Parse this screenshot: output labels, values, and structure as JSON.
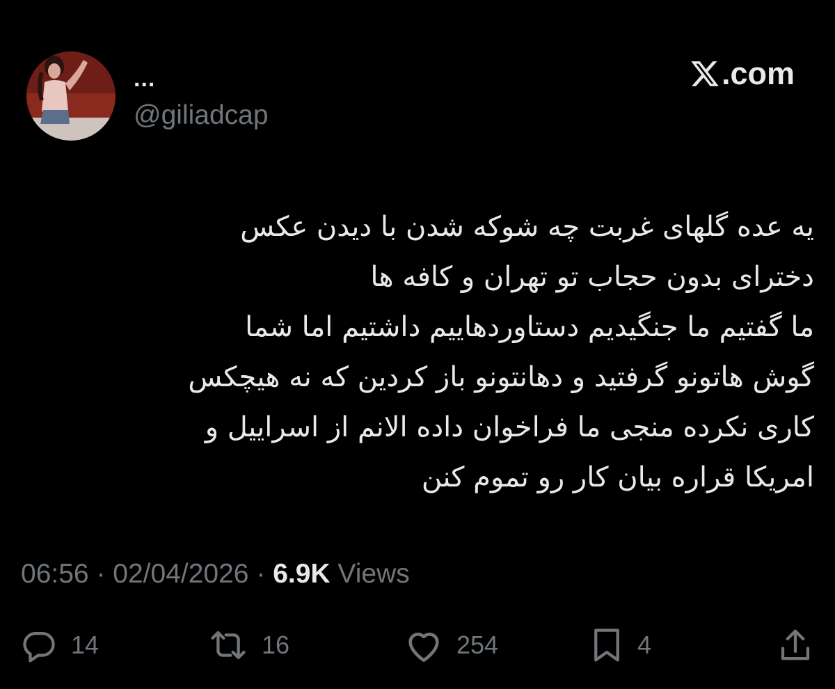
{
  "author": {
    "display_name": "...",
    "handle": "@giliadcap",
    "avatar_icon": "profile-photo"
  },
  "brand": {
    "text": ".com",
    "icon": "x-logo-icon"
  },
  "tweet": {
    "lines": [
      "یه عده گلهای غربت چه شوکه شدن با دیدن عکس",
      "دخترای بدون حجاب تو تهران و کافه ها",
      "ما گفتیم ما جنگیدیم دستاوردهاییم داشتیم اما شما",
      "گوش هاتونو گرفتید و دهانتونو باز کردین که نه هیچکس",
      "کاری نکرده منجی ما فراخوان داده الانم از اسراییل و",
      "امریکا قراره بیان کار رو تموم کنن"
    ]
  },
  "meta": {
    "time": "06:56",
    "separator": "·",
    "date": "02/04/2026",
    "views_count": "6.9K",
    "views_label": "Views"
  },
  "actions": {
    "reply": {
      "icon": "reply-icon",
      "count": "14"
    },
    "retweet": {
      "icon": "retweet-icon",
      "count": "16"
    },
    "like": {
      "icon": "heart-icon",
      "count": "254"
    },
    "bookmark": {
      "icon": "bookmark-icon",
      "count": "4"
    },
    "share": {
      "icon": "share-icon"
    }
  },
  "colors": {
    "background": "#000000",
    "primary_text": "#e7e9ea",
    "secondary_text": "#71767b"
  }
}
